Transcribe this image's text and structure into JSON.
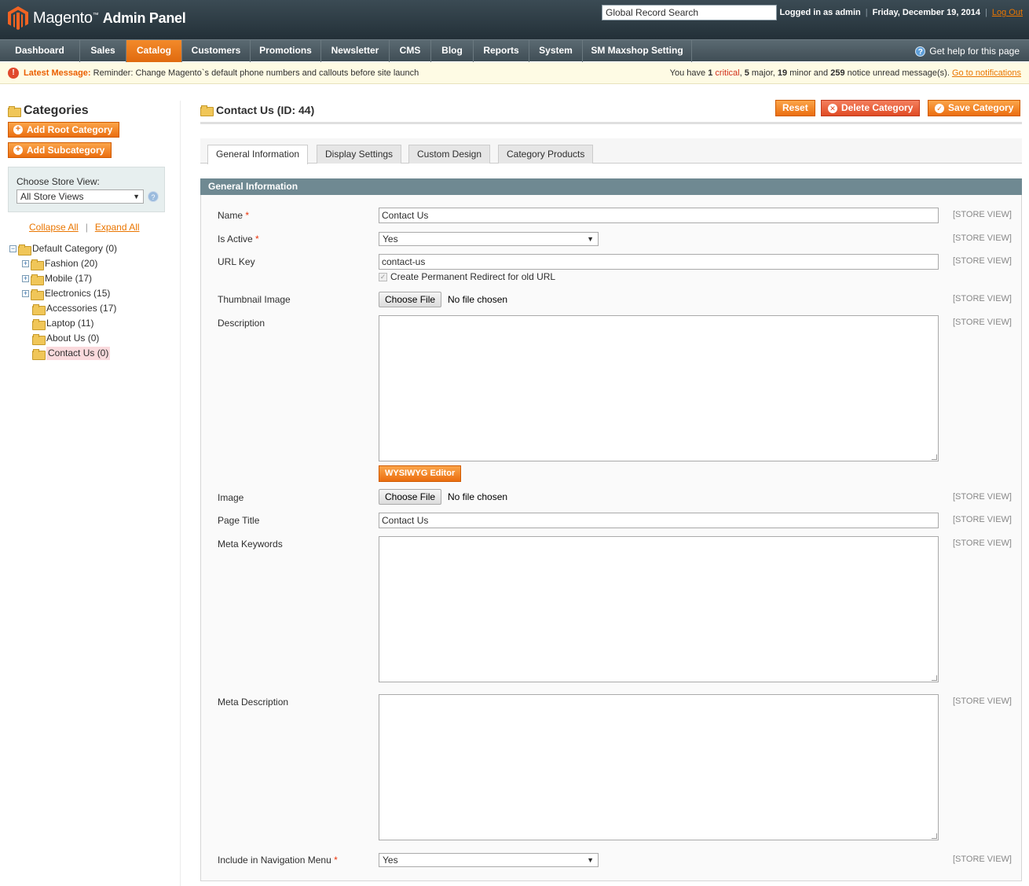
{
  "header": {
    "logo_brand": "Magento",
    "logo_suffix": "Admin Panel",
    "search_value": "Global Record Search",
    "logged_in": "Logged in as admin",
    "date": "Friday, December 19, 2014",
    "logout": "Log Out"
  },
  "nav": {
    "items": [
      "Dashboard",
      "Sales",
      "Catalog",
      "Customers",
      "Promotions",
      "Newsletter",
      "CMS",
      "Blog",
      "Reports",
      "System",
      "SM Maxshop Setting"
    ],
    "active": "Catalog",
    "help": "Get help for this page"
  },
  "message": {
    "label": "Latest Message:",
    "text": "Reminder: Change Magento`s default phone numbers and callouts before site launch",
    "summary_prefix": "You have",
    "critical_count": "1",
    "critical_label": "critical",
    "major": "5",
    "major_label": "major,",
    "minor": "19",
    "minor_label": "minor and",
    "notice": "259",
    "notice_label": "notice unread message(s).",
    "link": "Go to notifications"
  },
  "sidebar": {
    "title": "Categories",
    "add_root": "Add Root Category",
    "add_sub": "Add Subcategory",
    "store_label": "Choose Store View:",
    "store_value": "All Store Views",
    "collapse_all": "Collapse All",
    "expand_all": "Expand All",
    "tree": [
      {
        "label": "Default Category (0)"
      },
      {
        "label": "Fashion (20)"
      },
      {
        "label": "Mobile (17)"
      },
      {
        "label": "Electronics (15)"
      },
      {
        "label": "Accessories (17)"
      },
      {
        "label": "Laptop (11)"
      },
      {
        "label": "About Us (0)"
      },
      {
        "label": "Contact Us (0)"
      }
    ]
  },
  "main": {
    "title": "Contact Us (ID: 44)",
    "reset": "Reset",
    "delete": "Delete Category",
    "save": "Save Category",
    "tabs": [
      "General Information",
      "Display Settings",
      "Custom Design",
      "Category Products"
    ],
    "section": "General Information"
  },
  "form": {
    "scope": "[STORE VIEW]",
    "name_label": "Name",
    "name_value": "Contact Us",
    "active_label": "Is Active",
    "active_value": "Yes",
    "urlkey_label": "URL Key",
    "urlkey_value": "contact-us",
    "redirect_label": "Create Permanent Redirect for old URL",
    "thumb_label": "Thumbnail Image",
    "choose_file": "Choose File",
    "no_file": "No file chosen",
    "desc_label": "Description",
    "wysiwyg": "WYSIWYG Editor",
    "image_label": "Image",
    "page_title_label": "Page Title",
    "page_title_value": "Contact Us",
    "meta_kw_label": "Meta Keywords",
    "meta_desc_label": "Meta Description",
    "nav_menu_label": "Include in Navigation Menu",
    "nav_menu_value": "Yes"
  },
  "colors": {
    "accent": "#eb6e10",
    "header": "#2d3840",
    "section": "#6f8992"
  }
}
